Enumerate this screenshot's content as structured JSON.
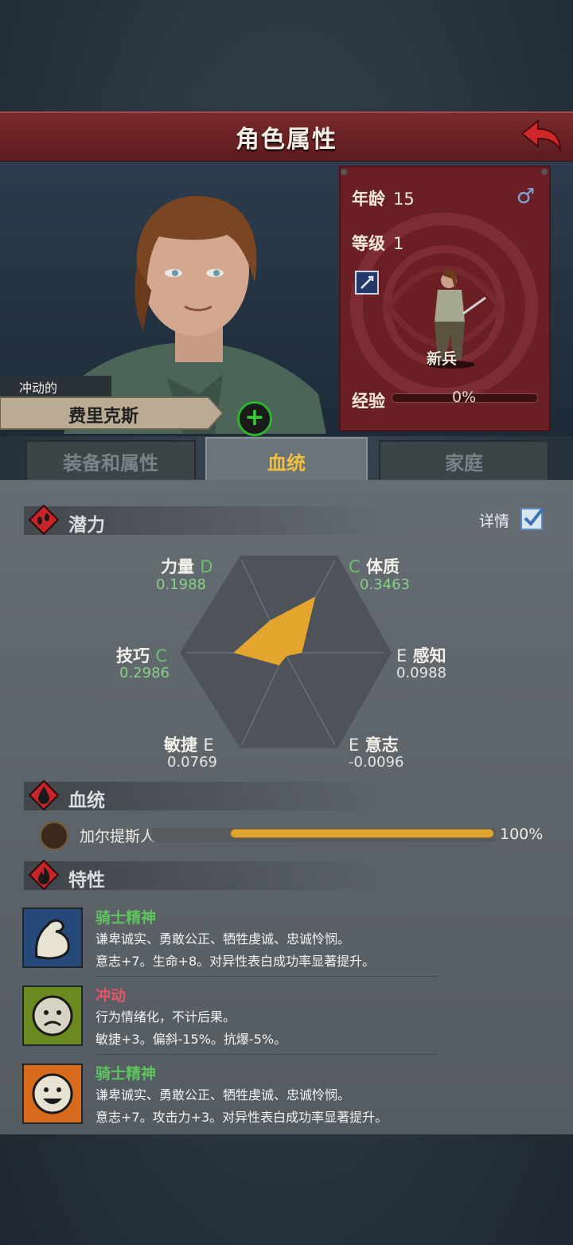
{
  "header": {
    "title": "角色属性"
  },
  "character": {
    "trait_tag": "冲动的",
    "name": "费里克斯",
    "age_label": "年龄",
    "age": "15",
    "gender_symbol": "♂",
    "level_label": "等级",
    "level": "1",
    "unit_label": "新兵",
    "exp_label": "经验",
    "exp_percent": "0%",
    "exp_fraction": 0
  },
  "tabs": [
    {
      "label": "装备和属性",
      "active": false
    },
    {
      "label": "血统",
      "active": true
    },
    {
      "label": "家庭",
      "active": false
    }
  ],
  "potential": {
    "section_label": "潜力",
    "details_label": "详情",
    "details_checked": true,
    "stats": [
      {
        "name": "力量",
        "grade": "D",
        "value": "0.1988",
        "value_num": 0.1988
      },
      {
        "name": "体质",
        "grade": "C",
        "value": "0.3463",
        "value_num": 0.3463
      },
      {
        "name": "感知",
        "grade": "E",
        "value": "0.0988",
        "value_num": 0.0988
      },
      {
        "name": "意志",
        "grade": "E",
        "value": "-0.0096",
        "value_num": -0.0096
      },
      {
        "name": "敏捷",
        "grade": "E",
        "value": "0.0769",
        "value_num": 0.0769
      },
      {
        "name": "技巧",
        "grade": "C",
        "value": "0.2986",
        "value_num": 0.2986
      }
    ],
    "radar_fill_color": "#e3a52e"
  },
  "bloodline": {
    "section_label": "血统",
    "name": "加尔提斯人",
    "percent": "100%",
    "fraction": 1.0,
    "bar_color": "#e0a42c"
  },
  "traits": {
    "section_label": "特性",
    "items": [
      {
        "name": "骑士精神",
        "color": "#5fc45f",
        "icon": "flexed-arm-icon",
        "line1": "谦卑诚实、勇敢公正、牺牲虔诚、忠诚怜悯。",
        "line2": "意志+7。生命+8。对异性表白成功率显著提升。"
      },
      {
        "name": "冲动",
        "color": "#e0566a",
        "icon": "sad-face-icon",
        "line1": "行为情绪化，不计后果。",
        "line2": "敏捷+3。偏斜-15%。抗爆-5%。"
      },
      {
        "name": "骑士精神",
        "color": "#5fc45f",
        "icon": "happy-face-icon",
        "line1": "谦卑诚实、勇敢公正、牺牲虔诚、忠诚怜悯。",
        "line2": "意志+7。攻击力+3。对异性表白成功率显著提升。"
      }
    ]
  }
}
